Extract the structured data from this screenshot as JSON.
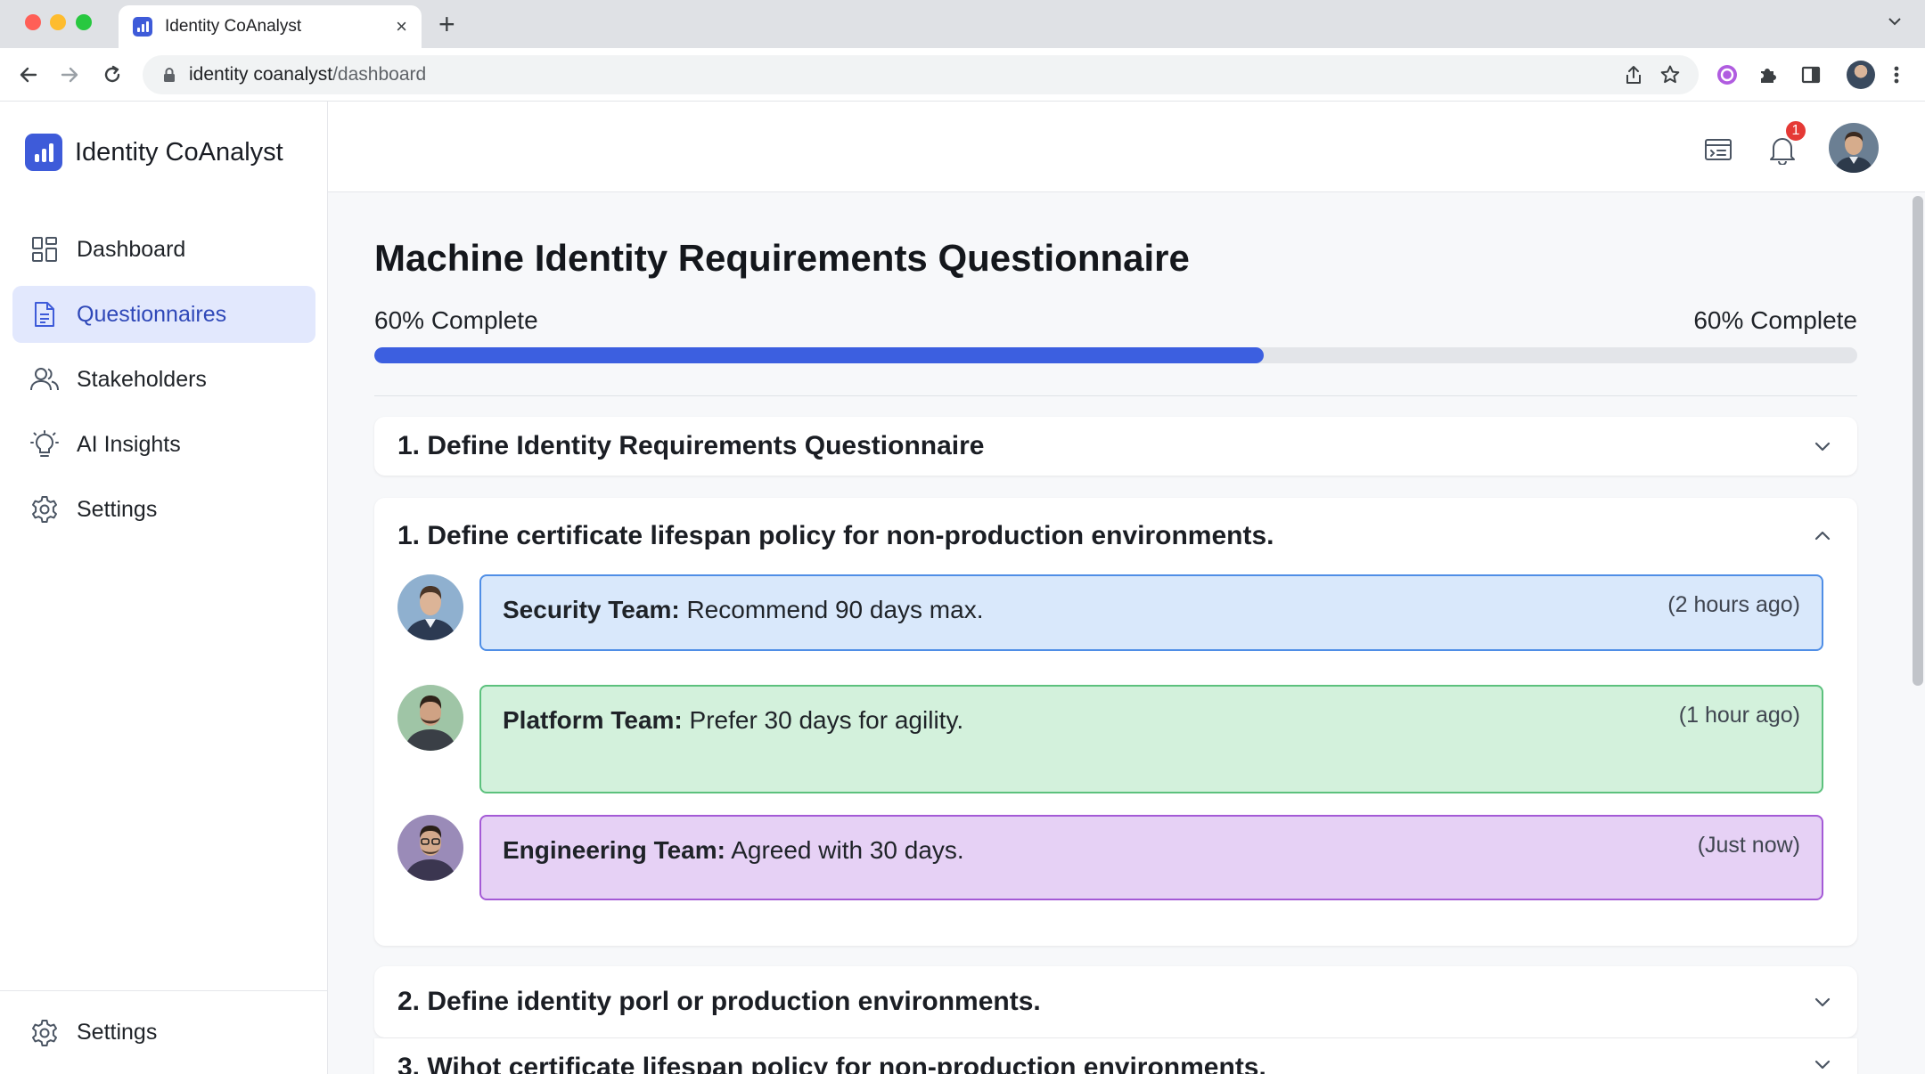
{
  "browser": {
    "tab_title": "Identity CoAnalyst",
    "tab_close": "×",
    "new_tab": "+",
    "url_host": "identity coanalyst",
    "url_path": "/dashboard"
  },
  "app": {
    "brand_name": "Identity CoAnalyst"
  },
  "sidebar": {
    "items": [
      {
        "label": "Dashboard",
        "icon": "grid-icon"
      },
      {
        "label": "Questionnaires",
        "icon": "document-icon",
        "active": true
      },
      {
        "label": "Stakeholders",
        "icon": "users-icon"
      },
      {
        "label": "AI Insights",
        "icon": "lightbulb-icon"
      },
      {
        "label": "Settings",
        "icon": "gear-icon"
      }
    ],
    "footer_label": "Settings"
  },
  "header": {
    "notification_count": "1"
  },
  "main": {
    "title": "Machine Identity Requirements Questionnaire",
    "progress_left": "60% Complete",
    "progress_right": "60% Complete",
    "progress_value": 0.6,
    "sections": [
      {
        "title": "1. Define Identity Requirements Questionnaire",
        "expanded": false
      },
      {
        "title": "1. Define certificate lifespan policy for non-production environments.",
        "expanded": true
      },
      {
        "title": "2. Define identity porl or production environments.",
        "expanded": false
      },
      {
        "title": "3. Wihot certificate lifespan policy for non-production environments.",
        "expanded": false
      }
    ],
    "comments": [
      {
        "team": "Security Team:",
        "text": " Recommend 90 days max.",
        "time": "(2 hours ago)"
      },
      {
        "team": "Platform Team:",
        "text": " Prefer 30 days for agility.",
        "time": "(1 hour ago)"
      },
      {
        "team": "Engineering Team:",
        "text": " Agreed with 30 days.",
        "time": "(Just now)"
      }
    ]
  },
  "colors": {
    "accent": "#3e5bd9",
    "progress": "#3c5fe0",
    "security_bg": "#d9e8fb",
    "security_border": "#4f8ee6",
    "platform_bg": "#d3f1dc",
    "platform_border": "#5cc17d",
    "engineering_bg": "#e6d1f5",
    "engineering_border": "#a45ad6"
  }
}
